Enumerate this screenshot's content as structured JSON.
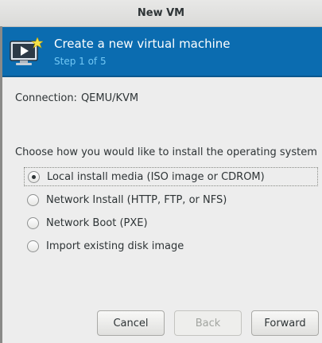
{
  "window": {
    "title": "New VM"
  },
  "banner": {
    "title": "Create a new virtual machine",
    "step": "Step 1 of 5",
    "icon": "vm-monitor-icon",
    "background_color": "#0b6cb0",
    "step_color": "#72c8f5"
  },
  "connection": {
    "label": "Connection:",
    "value": "QEMU/KVM"
  },
  "install": {
    "prompt": "Choose how you would like to install the operating system",
    "options": [
      {
        "label": "Local install media (ISO image or CDROM)",
        "selected": true
      },
      {
        "label": "Network Install (HTTP, FTP, or NFS)",
        "selected": false
      },
      {
        "label": "Network Boot (PXE)",
        "selected": false
      },
      {
        "label": "Import existing disk image",
        "selected": false
      }
    ]
  },
  "buttons": {
    "cancel": {
      "label": "Cancel",
      "enabled": true
    },
    "back": {
      "label": "Back",
      "enabled": false
    },
    "forward": {
      "label": "Forward",
      "enabled": true
    }
  }
}
